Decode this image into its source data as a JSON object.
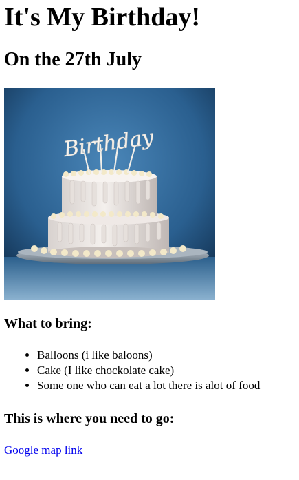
{
  "title": "It's My Birthday!",
  "date_heading": "On the 27th July",
  "cake_image": {
    "topper_text": "Birthday"
  },
  "bring": {
    "heading": "What to bring:",
    "items": [
      "Balloons (i like baloons)",
      "Cake (I like chockolate cake)",
      "Some one who can eat a lot there is alot of food"
    ]
  },
  "location": {
    "heading": "This is where you need to go:",
    "link_text": "Google map link"
  },
  "colors": {
    "link": "#0000ee",
    "image_background": "#2f6b9e"
  }
}
